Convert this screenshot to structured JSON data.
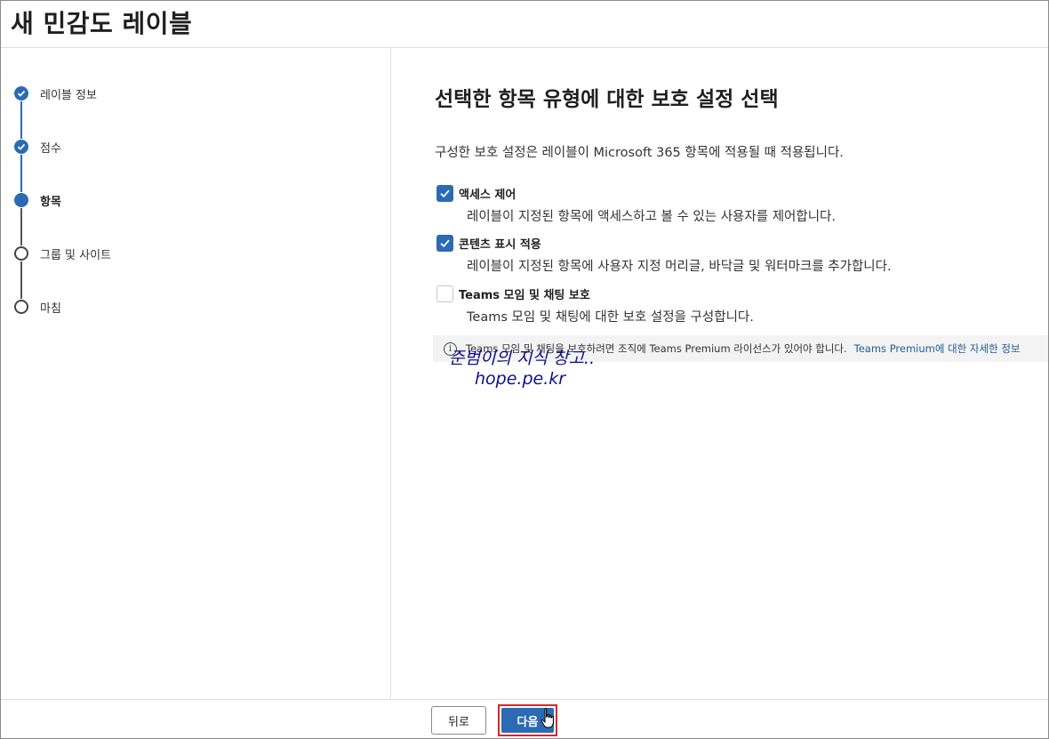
{
  "header": {
    "title": "새 민감도 레이블"
  },
  "sidebar": {
    "steps": [
      {
        "label": "레이블 정보",
        "state": "done"
      },
      {
        "label": "점수",
        "state": "done"
      },
      {
        "label": "항목",
        "state": "current"
      },
      {
        "label": "그룹 및 사이트",
        "state": "todo"
      },
      {
        "label": "마침",
        "state": "todo"
      }
    ]
  },
  "main": {
    "title": "선택한 항목 유형에 대한 보호 설정 선택",
    "description": "구성한 보호 설정은 레이블이 Microsoft 365 항목에 적용될 때 적용됩니다.",
    "options": [
      {
        "title": "액세스 제어",
        "subtitle": "레이블이 지정된 항목에 액세스하고 볼 수 있는 사용자를 제어합니다.",
        "checked": true
      },
      {
        "title": "콘텐츠 표시 적용",
        "subtitle": "레이블이 지정된 항목에 사용자 지정 머리글, 바닥글 및 워터마크를 추가합니다.",
        "checked": true
      },
      {
        "title": "Teams 모임 및 채팅 보호",
        "subtitle": "Teams 모임 및 채팅에 대한 보호 설정을 구성합니다.",
        "checked": false
      }
    ],
    "info": {
      "message": "Teams 모임 및 채팅을 보호하려면 조직에 Teams Premium 라이선스가 있어야 합니다.",
      "link": "Teams Premium에 대한 자세한 정보"
    }
  },
  "watermark": {
    "line1": "준범이의 지식 창고..",
    "line2": "hope.pe.kr"
  },
  "footer": {
    "back_label": "뒤로",
    "next_label": "다음"
  },
  "colors": {
    "accent": "#2c6ab3",
    "highlight": "#d12a2a",
    "watermark": "#10108c"
  }
}
